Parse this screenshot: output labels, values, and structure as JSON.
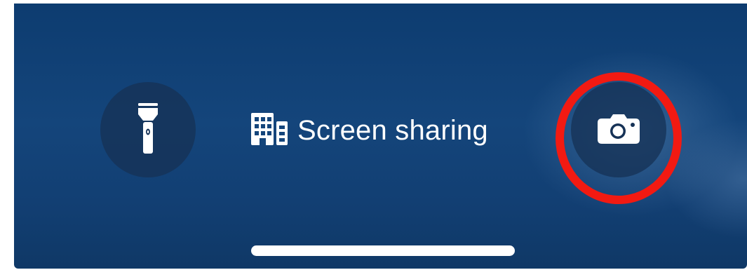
{
  "lock_screen": {
    "flashlight": {
      "icon": "flashlight-icon"
    },
    "screen_sharing": {
      "icon": "screen-share-icon",
      "label": "Screen sharing"
    },
    "camera": {
      "icon": "camera-icon"
    },
    "highlight": {
      "color": "#f21a12",
      "target": "camera"
    }
  },
  "colors": {
    "background": "#14457b",
    "button_fill": "#163256",
    "highlight": "#f21a12",
    "foreground": "#ffffff"
  }
}
